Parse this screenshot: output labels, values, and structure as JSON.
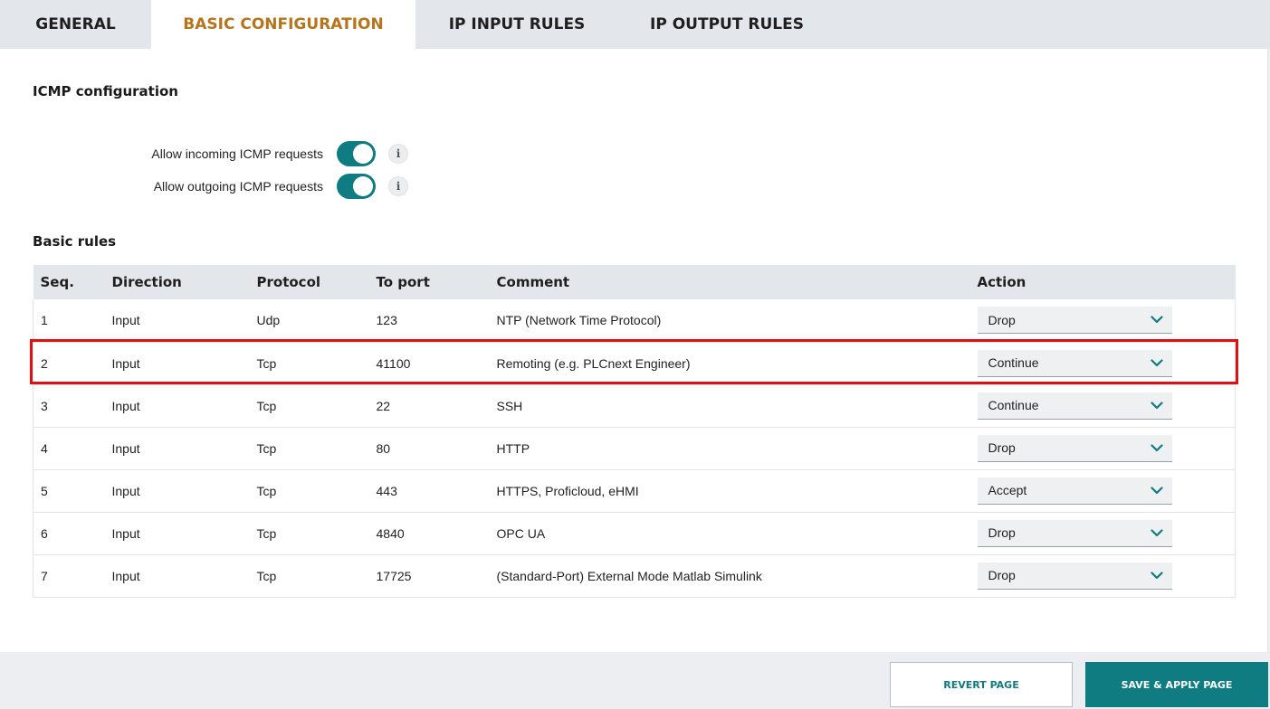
{
  "tabs": [
    {
      "label": "GENERAL"
    },
    {
      "label": "BASIC CONFIGURATION"
    },
    {
      "label": "IP INPUT RULES"
    },
    {
      "label": "IP OUTPUT RULES"
    }
  ],
  "icmp": {
    "title": "ICMP configuration",
    "incoming_label": "Allow incoming ICMP requests",
    "incoming_on": true,
    "outgoing_label": "Allow outgoing ICMP requests",
    "outgoing_on": true,
    "info_glyph": "i"
  },
  "basic_rules": {
    "title": "Basic rules",
    "columns": [
      "Seq.",
      "Direction",
      "Protocol",
      "To port",
      "Comment",
      "Action"
    ],
    "rows": [
      {
        "seq": "1",
        "direction": "Input",
        "protocol": "Udp",
        "port": "123",
        "comment": "NTP (Network Time Protocol)",
        "action": "Drop"
      },
      {
        "seq": "2",
        "direction": "Input",
        "protocol": "Tcp",
        "port": "41100",
        "comment": "Remoting (e.g. PLCnext Engineer)",
        "action": "Continue"
      },
      {
        "seq": "3",
        "direction": "Input",
        "protocol": "Tcp",
        "port": "22",
        "comment": "SSH",
        "action": "Continue"
      },
      {
        "seq": "4",
        "direction": "Input",
        "protocol": "Tcp",
        "port": "80",
        "comment": "HTTP",
        "action": "Drop"
      },
      {
        "seq": "5",
        "direction": "Input",
        "protocol": "Tcp",
        "port": "443",
        "comment": "HTTPS, Proficloud, eHMI",
        "action": "Accept"
      },
      {
        "seq": "6",
        "direction": "Input",
        "protocol": "Tcp",
        "port": "4840",
        "comment": "OPC UA",
        "action": "Drop"
      },
      {
        "seq": "7",
        "direction": "Input",
        "protocol": "Tcp",
        "port": "17725",
        "comment": "(Standard-Port) External Mode Matlab Simulink",
        "action": "Drop"
      }
    ]
  },
  "footer": {
    "revert_label": "REVERT PAGE",
    "save_label": "SAVE & APPLY PAGE"
  },
  "colors": {
    "accent": "#0e7c80",
    "active_tab": "#b8741a",
    "highlight": "#dd1111"
  }
}
